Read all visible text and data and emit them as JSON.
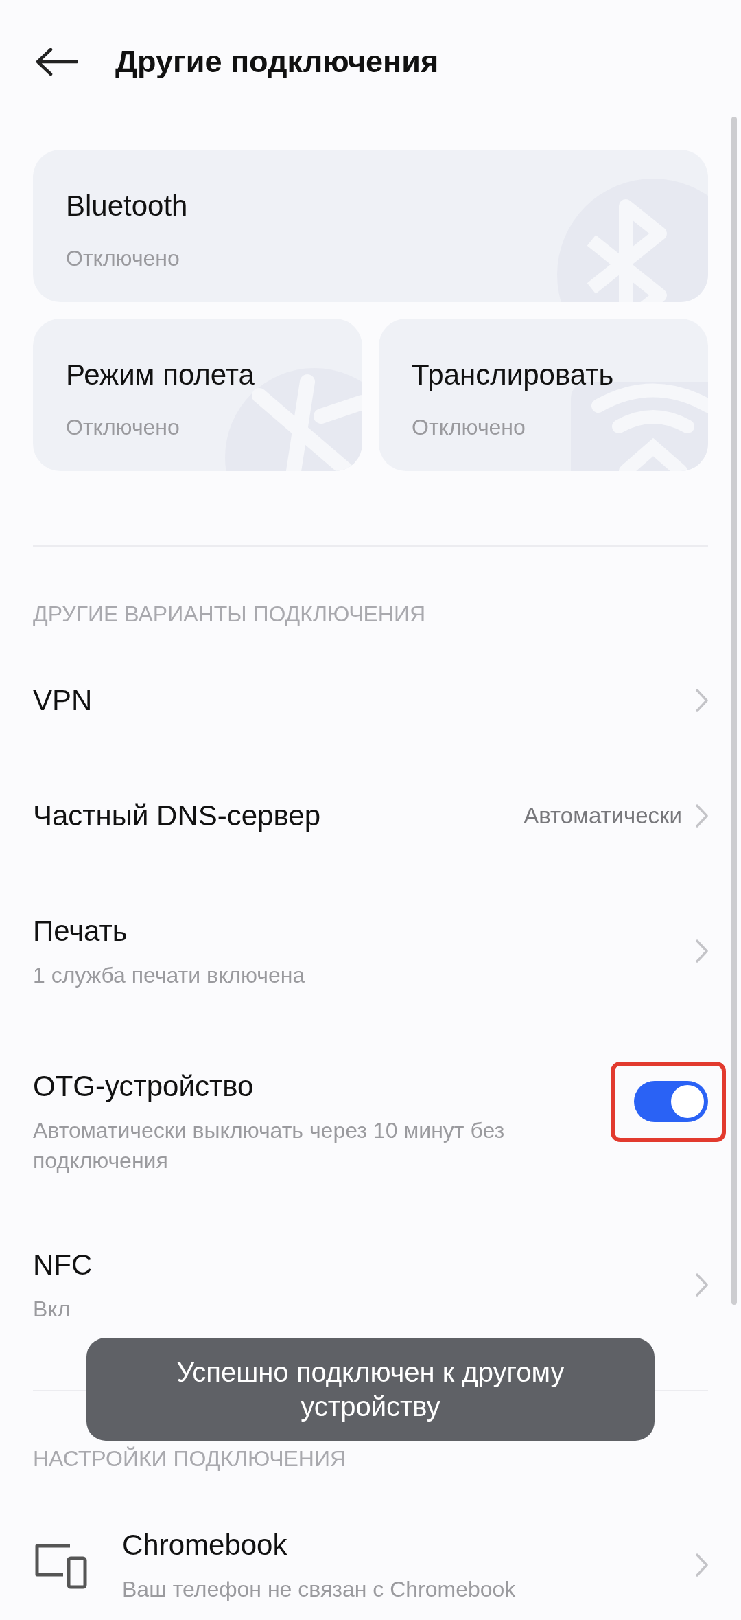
{
  "header": {
    "title": "Другие подключения"
  },
  "tiles": [
    {
      "kind": "bluetooth",
      "title": "Bluetooth",
      "status": "Отключено"
    },
    {
      "kind": "airplane",
      "title": "Режим полета",
      "status": "Отключено"
    },
    {
      "kind": "cast",
      "title": "Транслировать",
      "status": "Отключено"
    }
  ],
  "sections": [
    {
      "heading": "ДРУГИЕ ВАРИАНТЫ ПОДКЛЮЧЕНИЯ",
      "items": [
        {
          "kind": "link",
          "title": "VPN"
        },
        {
          "kind": "link",
          "title": "Частный DNS-сервер",
          "value": "Автоматически"
        },
        {
          "kind": "link",
          "title": "Печать",
          "subtitle": "1 служба печати включена"
        },
        {
          "kind": "switch",
          "title": "OTG-устройство",
          "subtitle": "Автоматически выключать через 10 минут без подключения",
          "on": true,
          "highlighted": true
        },
        {
          "kind": "link",
          "title": "NFC",
          "subtitle": "Вкл"
        }
      ]
    },
    {
      "heading": "НАСТРОЙКИ ПОДКЛЮЧЕНИЯ",
      "items": [
        {
          "kind": "device_link",
          "title": "Chromebook",
          "subtitle": "Ваш телефон не связан с Chromebook"
        }
      ]
    }
  ],
  "toast": {
    "message": "Успешно подключен к другому устройству"
  }
}
